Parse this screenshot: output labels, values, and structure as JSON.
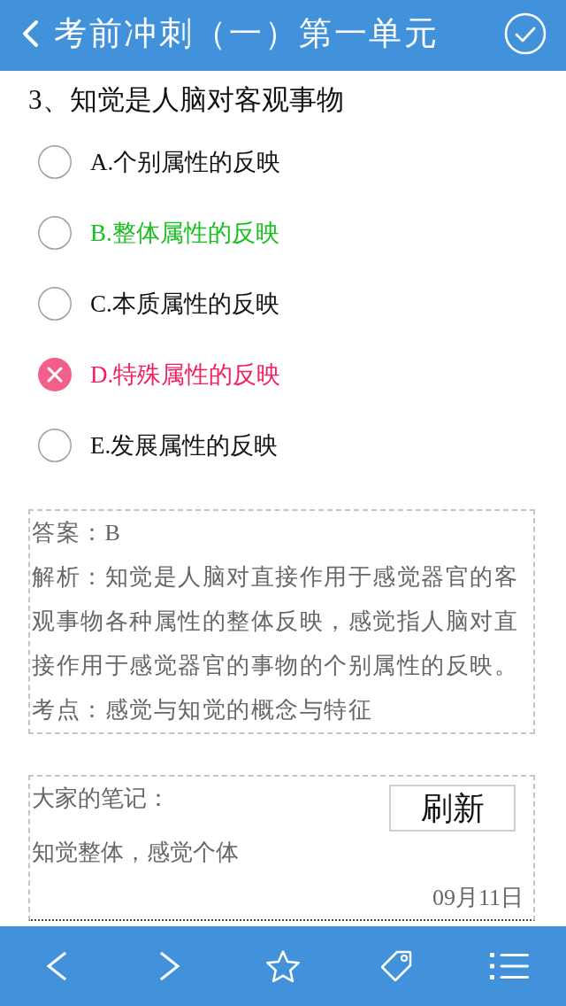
{
  "header": {
    "title": "考前冲刺（一）第一单元"
  },
  "question": {
    "text": "3、知觉是人脑对客观事物"
  },
  "options": [
    {
      "text": "A.个别属性的反映",
      "selected": false,
      "correct": false
    },
    {
      "text": "B.整体属性的反映",
      "selected": false,
      "correct": true
    },
    {
      "text": "C.本质属性的反映",
      "selected": false,
      "correct": false
    },
    {
      "text": "D.特殊属性的反映",
      "selected": true,
      "correct": false
    },
    {
      "text": "E.发展属性的反映",
      "selected": false,
      "correct": false
    }
  ],
  "answer_panel": {
    "answer": "答案：B",
    "analysis": "解析：知觉是人脑对直接作用于感觉器官的客观事物各种属性的整体反映，感觉指人脑对直接作用于感觉器官的事物的个别属性的反映。",
    "key_point": "考点：感觉与知觉的概念与特征"
  },
  "notes": {
    "title": "大家的笔记：",
    "refresh_button": "刷新",
    "items": [
      {
        "text": "知觉整体，感觉个体",
        "date": "09月11日"
      }
    ]
  }
}
